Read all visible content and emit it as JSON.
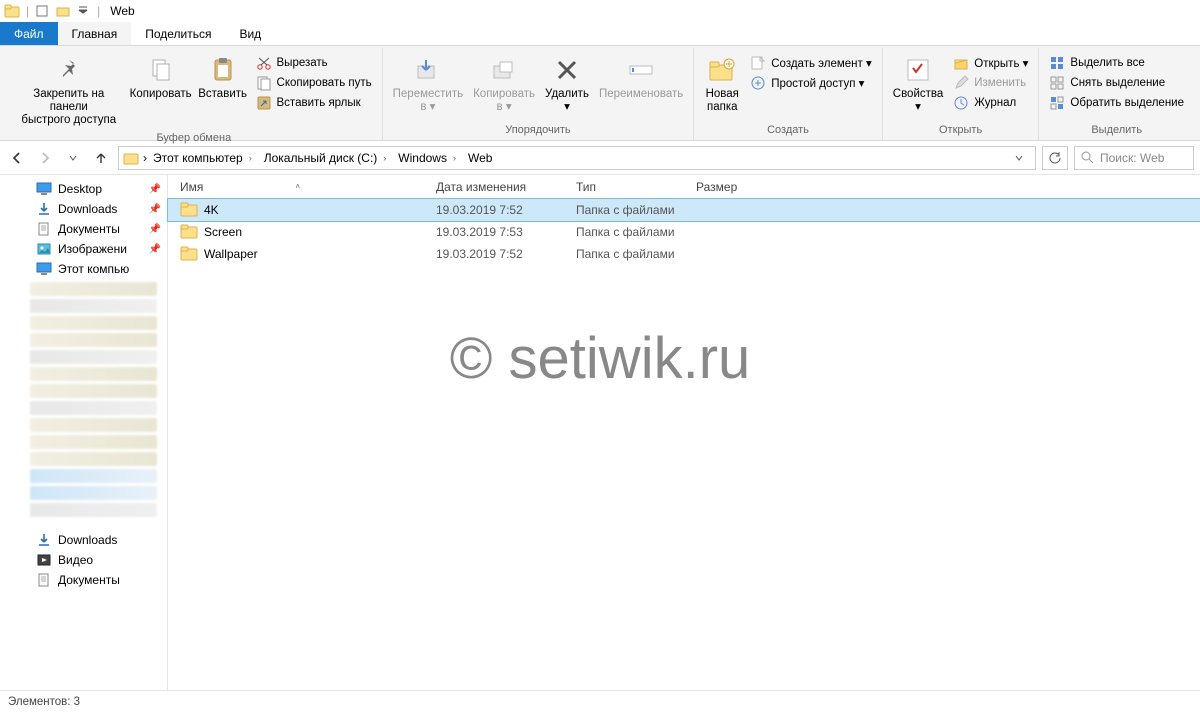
{
  "title": {
    "name": "Web"
  },
  "tabs": {
    "file": "Файл",
    "home": "Главная",
    "share": "Поделиться",
    "view": "Вид"
  },
  "ribbon": {
    "clipboard": {
      "label": "Буфер обмена",
      "pin": "Закрепить на панели\nбыстрого доступа",
      "copy": "Копировать",
      "paste": "Вставить",
      "cut": "Вырезать",
      "copypath": "Скопировать путь",
      "pasteShortcut": "Вставить ярлык"
    },
    "organize": {
      "label": "Упорядочить",
      "moveTo": "Переместить\nв ▾",
      "copyTo": "Копировать\nв ▾",
      "delete": "Удалить\n▾",
      "rename": "Переименовать"
    },
    "create": {
      "label": "Создать",
      "newFolder": "Новая\nпапка",
      "newItem": "Создать элемент ▾",
      "easyAccess": "Простой доступ ▾"
    },
    "open": {
      "label": "Открыть",
      "properties": "Свойства\n▾",
      "open": "Открыть ▾",
      "edit": "Изменить",
      "history": "Журнал"
    },
    "select": {
      "label": "Выделить",
      "selectAll": "Выделить все",
      "selectNone": "Снять выделение",
      "invert": "Обратить выделение"
    }
  },
  "breadcrumbs": [
    "Этот компьютер",
    "Локальный диск (C:)",
    "Windows",
    "Web"
  ],
  "search": {
    "placeholder": "Поиск: Web"
  },
  "columns": {
    "name": "Имя",
    "date": "Дата изменения",
    "type": "Тип",
    "size": "Размер"
  },
  "sidebar": {
    "items": [
      {
        "label": "Desktop",
        "icon": "monitor",
        "pinned": true
      },
      {
        "label": "Downloads",
        "icon": "download",
        "pinned": true
      },
      {
        "label": "Документы",
        "icon": "doc",
        "pinned": true
      },
      {
        "label": "Изображени",
        "icon": "pictures",
        "pinned": true
      },
      {
        "label": "Этот компью",
        "icon": "pc",
        "pinned": false
      }
    ],
    "bottom": [
      {
        "label": "Downloads",
        "icon": "download"
      },
      {
        "label": "Видео",
        "icon": "video"
      },
      {
        "label": "Документы",
        "icon": "doc"
      }
    ]
  },
  "files": [
    {
      "name": "4K",
      "date": "19.03.2019 7:52",
      "type": "Папка с файлами",
      "selected": true
    },
    {
      "name": "Screen",
      "date": "19.03.2019 7:53",
      "type": "Папка с файлами",
      "selected": false
    },
    {
      "name": "Wallpaper",
      "date": "19.03.2019 7:52",
      "type": "Папка с файлами",
      "selected": false
    }
  ],
  "status": {
    "count": "Элементов: 3"
  },
  "watermark": "© setiwik.ru"
}
